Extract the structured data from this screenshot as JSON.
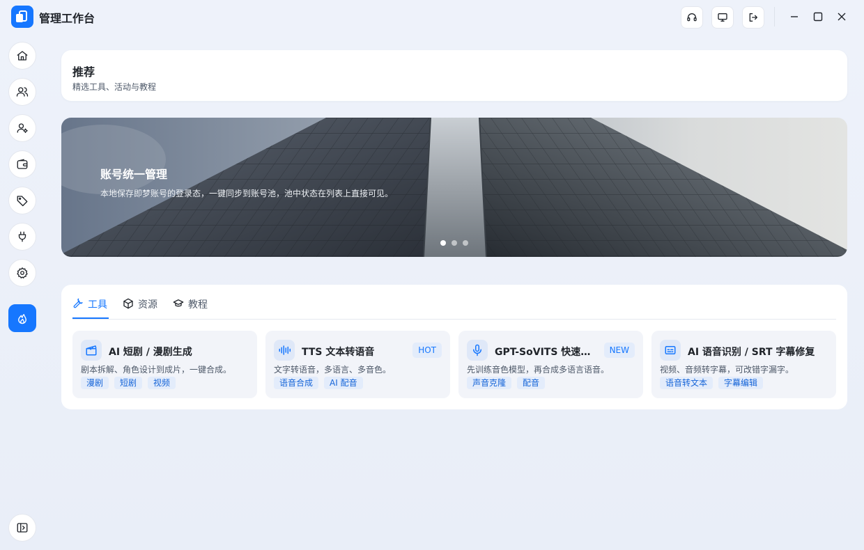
{
  "app": {
    "title": "管理工作台"
  },
  "titlebar": {
    "buttons": [
      "headset-icon",
      "monitor-icon",
      "logout-icon"
    ],
    "window_controls": [
      "minimize-icon",
      "maximize-icon",
      "close-icon"
    ]
  },
  "sidebar": {
    "items": [
      "home-icon",
      "users-icon",
      "user-settings-icon",
      "wallet-icon",
      "tag-icon",
      "plug-icon",
      "gear-icon",
      "flame-icon"
    ],
    "active": "flame-icon",
    "bottom": "sidebar-toggle-icon"
  },
  "recommend": {
    "title": "推荐",
    "subtitle": "精选工具、活动与教程"
  },
  "banner": {
    "title": "账号统一管理",
    "description": "本地保存即梦账号的登录态，一键同步到账号池，池中状态在列表上直接可见。",
    "slide_count": 3,
    "active_slide": 1
  },
  "tabs": [
    {
      "label": "工具",
      "icon": "wrench-icon",
      "active": true
    },
    {
      "label": "资源",
      "icon": "box-icon",
      "active": false
    },
    {
      "label": "教程",
      "icon": "graduation-cap-icon",
      "active": false
    }
  ],
  "tools": [
    {
      "icon": "clapperboard-icon",
      "title": "AI 短剧 / 漫剧生成",
      "badge": "",
      "desc": "剧本拆解、角色设计到成片，一键合成。",
      "tags": [
        "漫剧",
        "短剧",
        "视频"
      ]
    },
    {
      "icon": "audio-wave-icon",
      "title": "TTS 文本转语音",
      "badge": "HOT",
      "desc": "文字转语音，多语言、多音色。",
      "tags": [
        "语音合成",
        "AI 配音"
      ]
    },
    {
      "icon": "microphone-icon",
      "title": "GPT-SoVITS 快速音色克隆",
      "badge": "NEW",
      "desc": "先训练音色模型，再合成多语言语音。",
      "tags": [
        "声音克隆",
        "配音"
      ]
    },
    {
      "icon": "subtitles-icon",
      "title": "AI 语音识别 / SRT 字幕修复",
      "badge": "",
      "desc": "视频、音频转字幕，可改错字漏字。",
      "tags": [
        "语音转文本",
        "字幕编辑"
      ]
    }
  ],
  "colors": {
    "accent": "#1677ff",
    "background": "#eef2fa",
    "card": "#ffffff",
    "tag_bg": "#e3ecfb"
  }
}
